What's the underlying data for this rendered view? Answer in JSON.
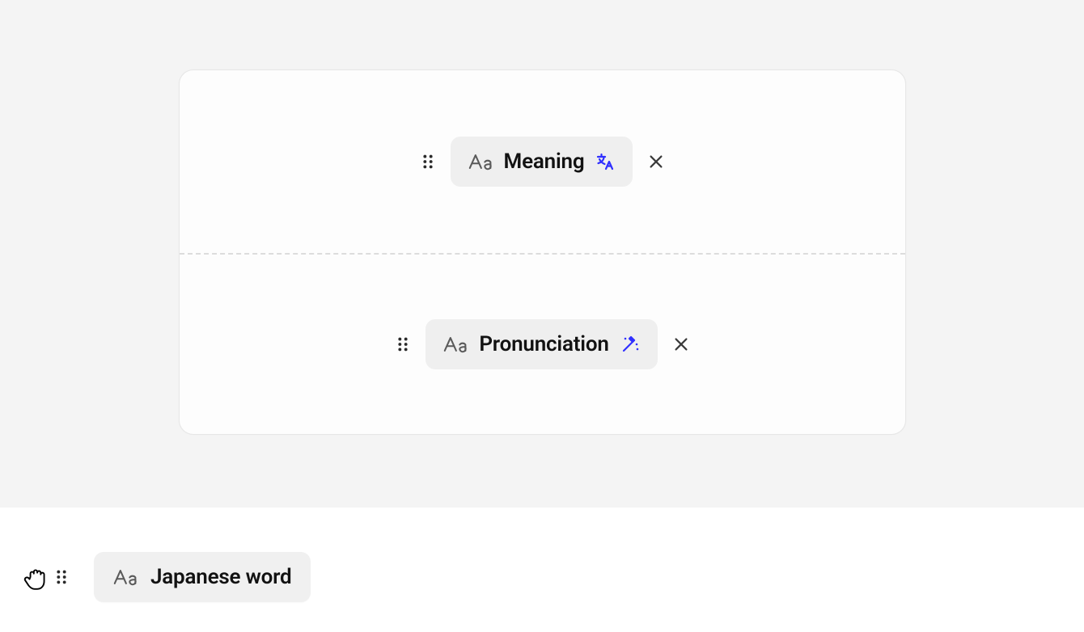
{
  "card": {
    "fields": [
      {
        "label": "Meaning",
        "action": "translate"
      },
      {
        "label": "Pronunciation",
        "action": "wand"
      }
    ]
  },
  "dragging": {
    "label": "Japanese word"
  }
}
